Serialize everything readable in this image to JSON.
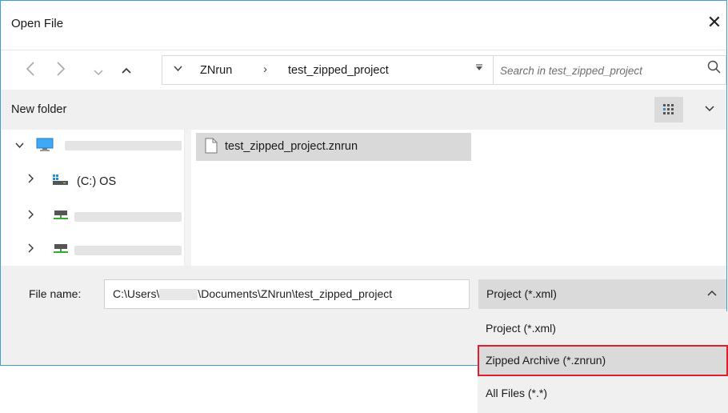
{
  "window": {
    "title": "Open File",
    "close_glyph": "✕"
  },
  "nav": {
    "back_icon": "chevron-left-icon",
    "forward_icon": "chevron-right-icon",
    "recent_icon": "chevron-down-icon",
    "up_icon": "arrow-up-icon"
  },
  "address": {
    "crumbs": [
      "ZNrun",
      "test_zipped_project"
    ],
    "chevron": "⌄",
    "separator": "›"
  },
  "search": {
    "placeholder": "Search in test_zipped_project",
    "icon": "search-icon"
  },
  "toolbar": {
    "new_folder_label": "New folder",
    "view_icon": "grid-view-icon"
  },
  "nav_pane": {
    "items": [
      {
        "icon": "computer-icon",
        "label": "",
        "expanded": true
      },
      {
        "icon": "drive-icon",
        "label": "(C:) OS",
        "expanded": false
      },
      {
        "icon": "network-drive-icon",
        "label": "",
        "expanded": false
      },
      {
        "icon": "network-drive-icon",
        "label": "",
        "expanded": false
      }
    ]
  },
  "files": [
    {
      "name": "test_zipped_project.znrun",
      "icon": "file-icon",
      "selected": true
    }
  ],
  "bottom": {
    "file_name_label": "File name:",
    "file_name_prefix": "C:\\Users\\",
    "file_name_suffix": "\\Documents\\ZNrun\\test_zipped_project",
    "file_type_selected": "Project (*.xml)",
    "file_type_options": [
      "Project (*.xml)",
      "Zipped Archive (*.znrun)",
      "All Files (*.*)"
    ],
    "highlighted_option_index": 1
  },
  "colors": {
    "dialog_border": "#3c9fd8",
    "highlight_border": "#e31e2c",
    "selection": "#d9d9d9"
  }
}
